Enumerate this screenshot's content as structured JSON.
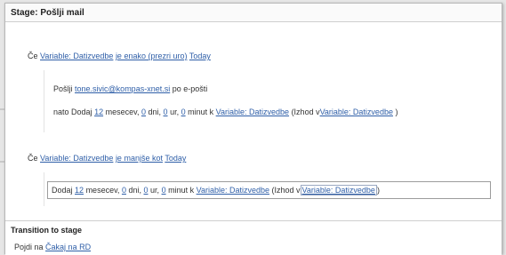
{
  "stage": {
    "title": "Stage: Pošlji mail"
  },
  "cond1": {
    "prefix": "Če",
    "variable": "Variable: Datizvedbe",
    "operator": "je enako (prezri uro)",
    "value": "Today"
  },
  "action1": {
    "prefix": "Pošlji",
    "email": "tone.sivic@kompas-xnet.si",
    "suffix": "po e-pošti"
  },
  "action2": {
    "prefix": "nato Dodaj",
    "months": "12",
    "t1": "mesecev,",
    "days": "0",
    "t2": "dni,",
    "hours": "0",
    "t3": "ur,",
    "minutes": "0",
    "t4": "minut k",
    "variable": "Variable: Datizvedbe",
    "t5": "(Izhod v",
    "output": "Variable: Datizvedbe",
    "t6": ")"
  },
  "cond2": {
    "prefix": "Če",
    "variable": "Variable: Datizvedbe",
    "operator": "je manjše kot",
    "value": "Today"
  },
  "action3": {
    "prefix": "Dodaj",
    "months": "12",
    "t1": "mesecev,",
    "days": "0",
    "t2": "dni,",
    "hours": "0",
    "t3": "ur,",
    "minutes": "0",
    "t4": "minut k",
    "variable": "Variable: Datizvedbe",
    "t5": "(Izhod v",
    "output": "Variable: Datizvedbe",
    "t6": ")"
  },
  "transition": {
    "title": "Transition to stage",
    "prefix": "Pojdi na",
    "target": "Čakaj na RD"
  }
}
